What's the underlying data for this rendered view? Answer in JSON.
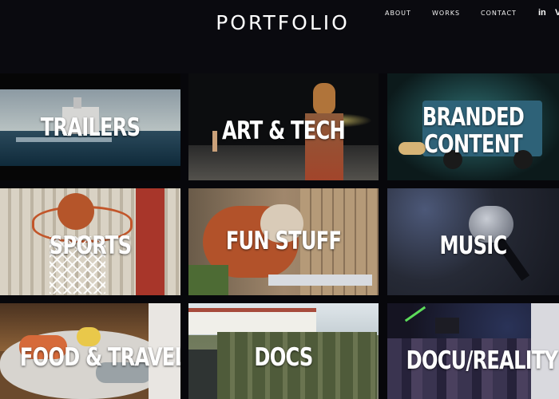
{
  "header": {
    "title": "PORTFOLIO",
    "nav": {
      "about": "ABOUT",
      "works": "WORKS",
      "contact": "CONTACT"
    },
    "social": {
      "linkedin": "in",
      "vimeo": "V"
    }
  },
  "tiles": [
    {
      "label": "TRAILERS",
      "icon": "ship-ocean-image"
    },
    {
      "label": "ART & TECH",
      "icon": "painted-performer-image"
    },
    {
      "label_line1": "BRANDED",
      "label_line2": "CONTENT",
      "icon": "food-truck-image"
    },
    {
      "label": "SPORTS",
      "icon": "basketball-hoop-image"
    },
    {
      "label": "FUN STUFF",
      "icon": "red-panda-image"
    },
    {
      "label": "MUSIC",
      "icon": "microphone-image"
    },
    {
      "label": "FOOD & TRAVEL",
      "icon": "seafood-platter-image"
    },
    {
      "label": "DOCS",
      "icon": "soldiers-marching-image"
    },
    {
      "label": "DOCU/REALITY",
      "icon": "nightclub-crowd-image"
    }
  ]
}
